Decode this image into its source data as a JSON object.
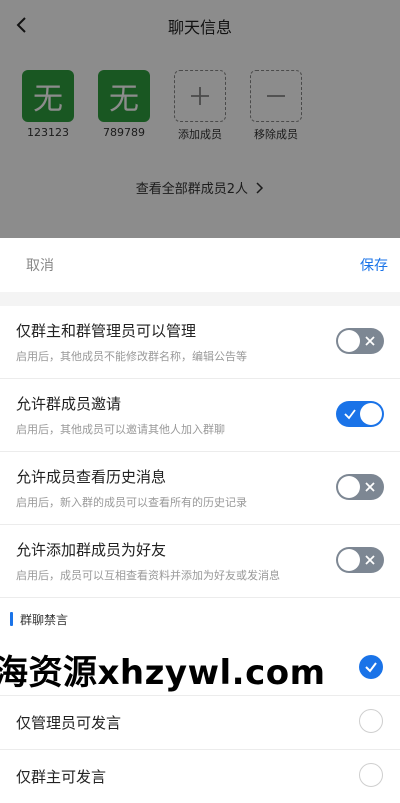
{
  "background": {
    "title": "聊天信息",
    "members": [
      {
        "avatar_text": "无",
        "name": "123123"
      },
      {
        "avatar_text": "无",
        "name": "789789"
      }
    ],
    "add_member": "添加成员",
    "remove_member": "移除成员",
    "view_all": "查看全部群成员2人"
  },
  "sheet": {
    "cancel": "取消",
    "save": "保存",
    "settings": [
      {
        "title": "仅群主和群管理员可以管理",
        "desc": "启用后，其他成员不能修改群名称，编辑公告等",
        "enabled": false
      },
      {
        "title": "允许群成员邀请",
        "desc": "启用后，其他成员可以邀请其他人加入群聊",
        "enabled": true
      },
      {
        "title": "允许成员查看历史消息",
        "desc": "启用后，新入群的成员可以查看所有的历史记录",
        "enabled": false
      },
      {
        "title": "允许添加群成员为好友",
        "desc": "启用后，成员可以互相查看资料并添加为好友或发消息",
        "enabled": false
      }
    ],
    "mute_section": "群聊禁言",
    "mute_options": [
      {
        "label": "",
        "selected": true
      },
      {
        "label": "仅管理员可发言",
        "selected": false
      },
      {
        "label": "仅群主可发言",
        "selected": false
      }
    ],
    "watermark": "海资源xhzywl.com"
  },
  "colors": {
    "accent": "#1a73e8",
    "toggle_off": "#7d8793",
    "avatar": "#2f9e3f"
  }
}
